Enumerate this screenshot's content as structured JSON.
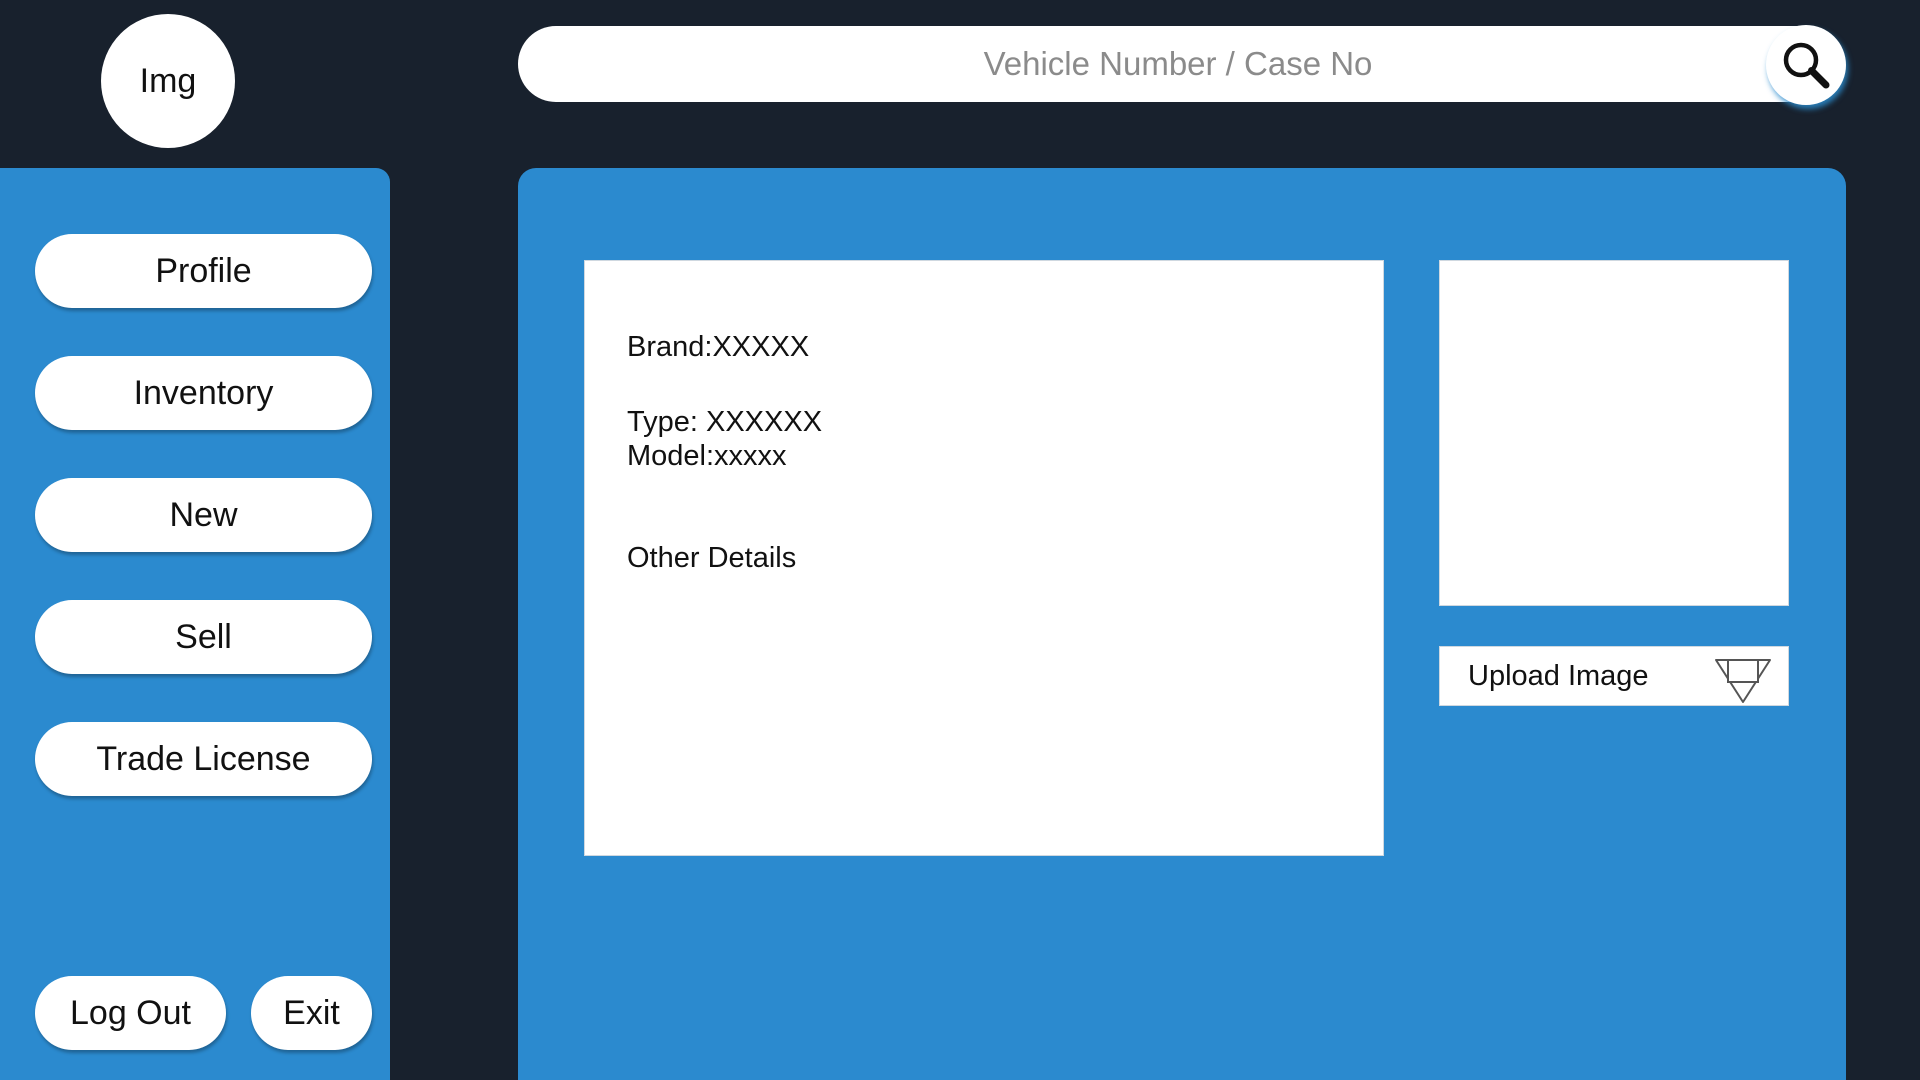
{
  "avatar": {
    "label": "Img"
  },
  "search": {
    "placeholder": "Vehicle Number / Case No",
    "icon": "search-icon"
  },
  "sidebar": {
    "items": [
      {
        "label": "Profile"
      },
      {
        "label": "Inventory"
      },
      {
        "label": "New"
      },
      {
        "label": "Sell"
      },
      {
        "label": "Trade License"
      }
    ],
    "logout_label": "Log Out",
    "exit_label": "Exit"
  },
  "details": {
    "brand": "Brand:XXXXX",
    "type": "Type: XXXXXX",
    "model": "Model:xxxxx",
    "other": "Other Details"
  },
  "upload": {
    "label": "Upload Image",
    "icon": "upload-icon"
  },
  "colors": {
    "background": "#18212d",
    "panel": "#2b8acf",
    "card": "#ffffff",
    "placeholder_text": "#8b8b8b"
  }
}
